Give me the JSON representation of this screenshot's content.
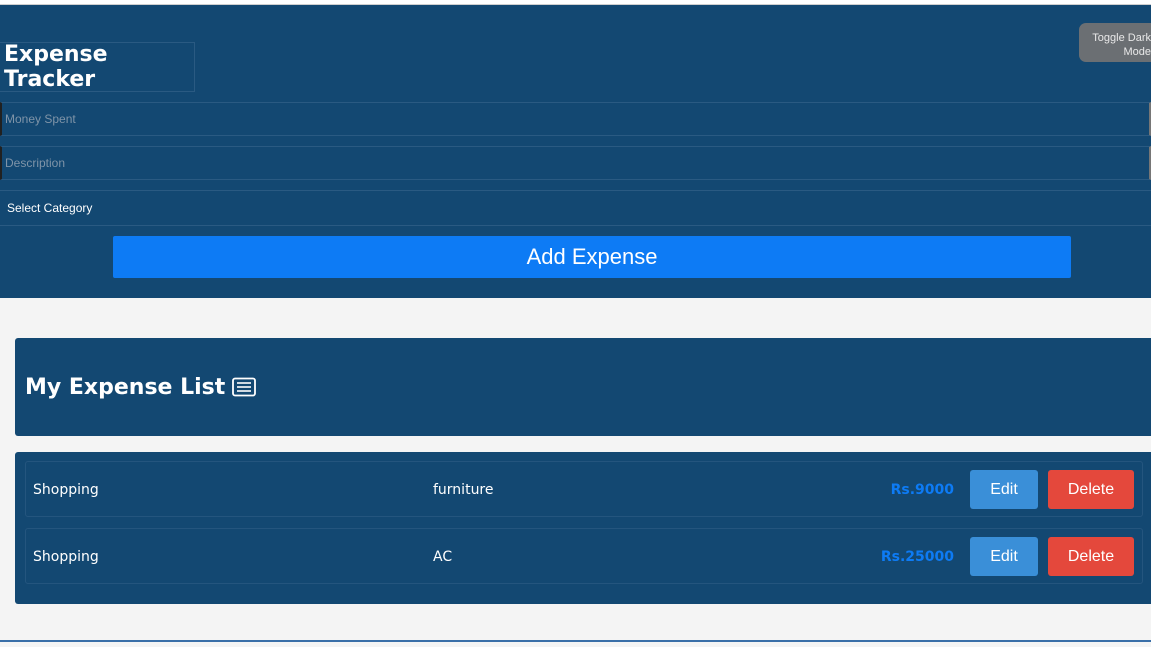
{
  "app": {
    "title": "Expense Tracker",
    "toggle_label": "Toggle Dark Mode"
  },
  "form": {
    "money_placeholder": "Money Spent",
    "description_placeholder": "Description",
    "category_selected": "Select Category",
    "add_button_label": "Add Expense"
  },
  "list": {
    "title": "My Expense List",
    "icon": "list-icon",
    "items": [
      {
        "category": "Shopping",
        "description": "furniture",
        "amount": "Rs.9000",
        "edit_label": "Edit",
        "delete_label": "Delete"
      },
      {
        "category": "Shopping",
        "description": "AC",
        "amount": "Rs.25000",
        "edit_label": "Edit",
        "delete_label": "Delete"
      }
    ]
  },
  "colors": {
    "panel": "#134872",
    "accent": "#0d7bf5",
    "edit": "#3a8fd8",
    "delete": "#e4483c",
    "background": "#f4f4f4"
  }
}
